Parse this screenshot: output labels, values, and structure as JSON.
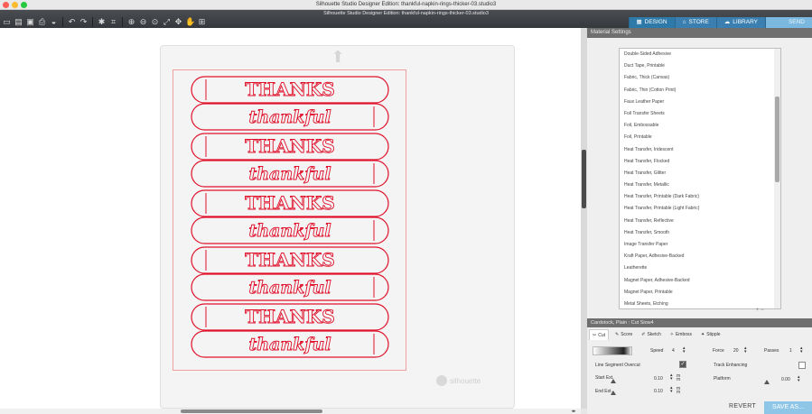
{
  "window": {
    "title": "Silhouette Studio Designer Edition: thankful-napkin-rings-thicker-03.studio3"
  },
  "toolbar": {
    "doc_title": "Silhouette Studio Designer Edition: thankful-napkin-rings-thicker-03.studio3",
    "tools": [
      "new-doc-icon",
      "open-icon",
      "save-icon",
      "print-icon",
      "cut-send-icon",
      "undo-icon",
      "redo-icon",
      "select-icon",
      "point-edit-icon",
      "zoom-in-icon",
      "zoom-out-icon",
      "zoom-box-icon",
      "zoom-fit-icon",
      "pan-icon",
      "grab-icon",
      "page-fit-icon"
    ]
  },
  "nav": {
    "design": "DESIGN",
    "store": "STORE",
    "library": "LIBRARY",
    "send": "SEND"
  },
  "canvas": {
    "brand": "silhouette",
    "artwork": {
      "pairs": 5,
      "word_top": "THANKS",
      "word_bottom": "thankful",
      "stroke_color": "#e0102a"
    }
  },
  "material_settings": {
    "header": "Material Settings",
    "items": [
      "Double-Sided Adhesive",
      "Duct Tape, Printable",
      "Fabric, Thick (Canvas)",
      "Fabric, Thin (Cotton Print)",
      "Faux Leather Paper",
      "Foil Transfer Sheets",
      "Foil, Embossable",
      "Foil, Printable",
      "Heat Transfer, Iridescent",
      "Heat Transfer, Flocked",
      "Heat Transfer, Glitter",
      "Heat Transfer, Metallic",
      "Heat Transfer, Printable (Dark Fabric)",
      "Heat Transfer, Printable (Light Fabric)",
      "Heat Transfer, Reflective",
      "Heat Transfer, Smooth",
      "Image Transfer Paper",
      "Kraft Paper, Adhesive-Backed",
      "Leatherette",
      "Magnet Paper, Adhesive-Backed",
      "Magnet Paper, Printable",
      "Metal Sheets, Etching"
    ],
    "add_remove": "+ −"
  },
  "cut_settings": {
    "header": "Cardstock, Plain : Cut Siow4",
    "modes": {
      "cut": "Cut",
      "score": "Score",
      "sketch": "Sketch",
      "emboss": "Emboss",
      "stipple": "Stipple"
    },
    "speed_label": "Speed",
    "speed_value": "4",
    "force_label": "Force",
    "force_value": "20",
    "passes_label": "Passes",
    "passes_value": "1",
    "line_segment_overcut": "Line Segment Overcut",
    "track_enhancing": "Track Enhancing",
    "start_ext_label": "Start Ext.",
    "start_ext_value": "0.10",
    "end_ext_label": "End Ext.",
    "end_ext_value": "0.10",
    "unit": "m m",
    "platform_label": "Platform",
    "platform_value": "0.00"
  },
  "actions": {
    "revert": "REVERT",
    "save_as": "SAVE AS..."
  },
  "colors": {
    "accent": "#3a7fb0",
    "cut_line": "#e0102a"
  }
}
